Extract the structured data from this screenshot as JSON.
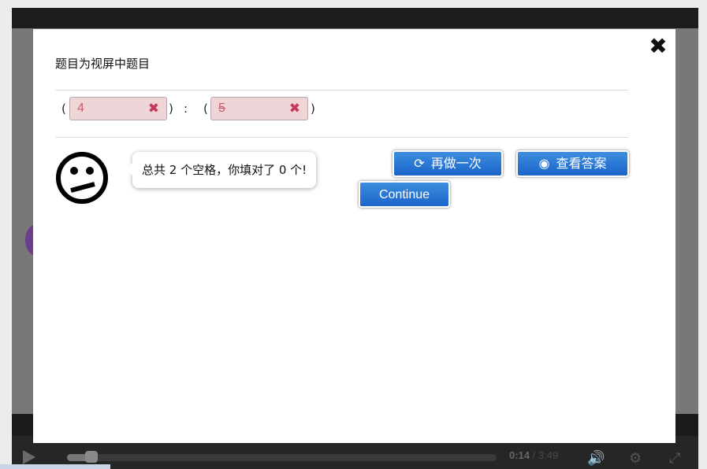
{
  "question": {
    "title": "题目为视屏中题目",
    "paren_open": "(",
    "paren_close": ")",
    "separator": ":",
    "blanks": [
      {
        "value": "4",
        "status": "wrong",
        "mark": "✖"
      },
      {
        "value": "5",
        "status": "wrong",
        "mark": "✖"
      }
    ]
  },
  "feedback": {
    "face_icon": "neutral-face-icon",
    "message": "总共 2 个空格，你填对了 0 个!"
  },
  "buttons": {
    "retry": {
      "icon": "refresh-icon",
      "icon_glyph": "⟳",
      "label": "再做一次"
    },
    "show_answer": {
      "icon": "eye-icon",
      "icon_glyph": "◉",
      "label": "查看答案"
    },
    "continue": {
      "label": "Continue"
    }
  },
  "modal": {
    "close_glyph": "✖"
  },
  "player": {
    "current_time": "0:14",
    "total_time": "/ 3:49",
    "progress": 0.06
  },
  "colors": {
    "button_blue": "#2574d4",
    "blank_wrong_bg": "#efd5d7",
    "wrong_mark": "#c8385a"
  }
}
